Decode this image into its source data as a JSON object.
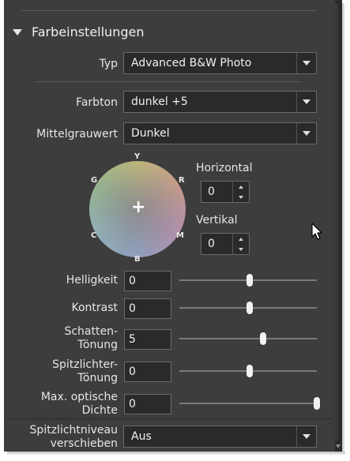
{
  "section": {
    "title": "Farbeinstellungen"
  },
  "typ": {
    "label": "Typ",
    "value": "Advanced B&W Photo"
  },
  "farbton": {
    "label": "Farbton",
    "value": "dunkel +5"
  },
  "mittelgrau": {
    "label": "Mittelgrauwert",
    "value": "Dunkel"
  },
  "wheel": {
    "labels": {
      "y": "Y",
      "r": "R",
      "m": "M",
      "b": "B",
      "c": "C",
      "g": "G"
    },
    "center_marker": "+"
  },
  "horizontal": {
    "label": "Horizontal",
    "value": "0"
  },
  "vertikal": {
    "label": "Vertikal",
    "value": "0"
  },
  "sliders": [
    {
      "label_lines": [
        "Helligkeit"
      ],
      "value": "0",
      "level": 0.5
    },
    {
      "label_lines": [
        "Kontrast"
      ],
      "value": "0",
      "level": 0.5
    },
    {
      "label_lines": [
        "Schatten-",
        "Tönung"
      ],
      "value": "5",
      "level": 0.6
    },
    {
      "label_lines": [
        "Spitzlichter-",
        "Tönung"
      ],
      "value": "0",
      "level": 0.5
    },
    {
      "label_lines": [
        "Max. optische",
        "Dichte"
      ],
      "value": "0",
      "level": 1.0
    }
  ],
  "spitzlicht": {
    "label_lines": [
      "Spitzlichtniveau",
      "verschieben"
    ],
    "value": "Aus"
  }
}
